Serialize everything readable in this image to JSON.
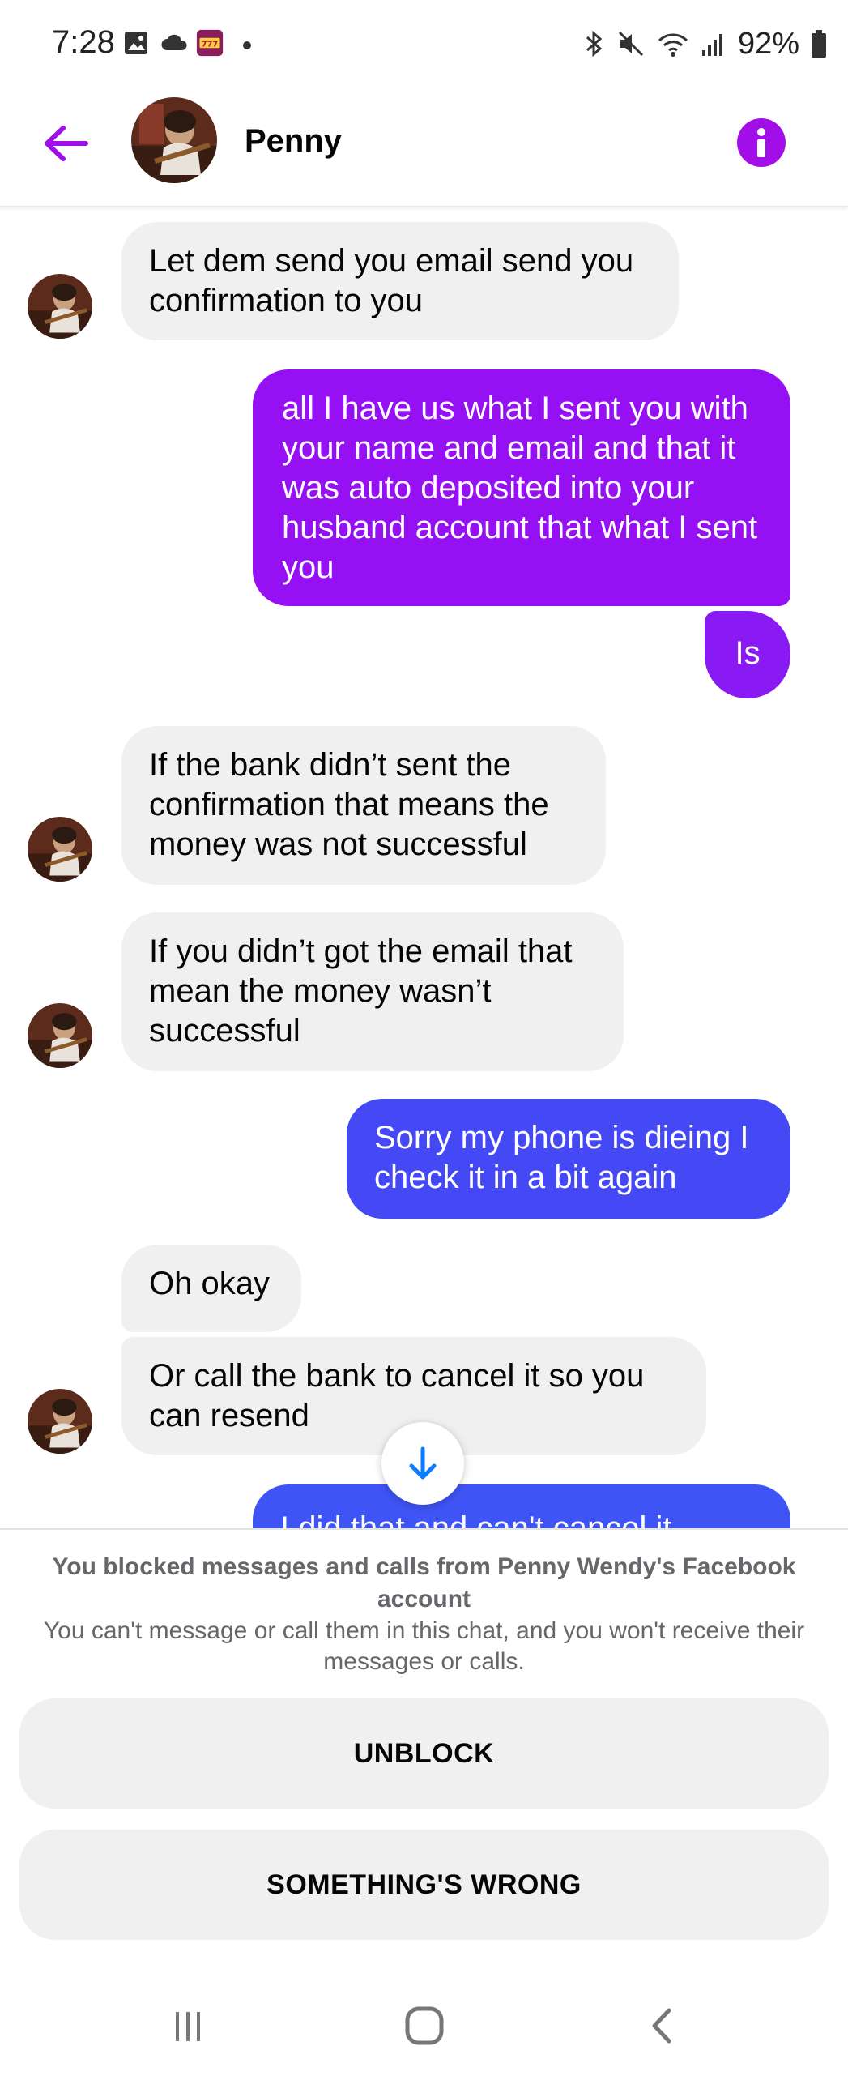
{
  "status_bar": {
    "time": "7:28",
    "battery": "92%",
    "left_icons": [
      "gallery-icon",
      "cloud-icon",
      "slots-app-icon",
      "dot-icon"
    ],
    "right_icons": [
      "bluetooth-icon",
      "mute-icon",
      "wifi-icon",
      "signal-icon",
      "battery-icon"
    ]
  },
  "header": {
    "contact_name": "Penny",
    "back_icon": "arrow-left-icon",
    "info_icon": "info-icon",
    "accent_color": "#a20ee8"
  },
  "messages": [
    {
      "direction": "incoming",
      "text": "Let dem send you email send you confirmation to you"
    },
    {
      "direction": "outgoing",
      "text": "all I have us what I sent you with your name and email and that it was auto deposited  into your husband account that what I sent you"
    },
    {
      "direction": "outgoing",
      "text": "Is"
    },
    {
      "direction": "incoming",
      "text": "If the bank didn’t sent the confirmation that means the money was not successful"
    },
    {
      "direction": "incoming",
      "text": "If you didn’t got the email that mean the money wasn’t successful"
    },
    {
      "direction": "outgoing",
      "text": "Sorry my phone is dieing I check it in a bit again"
    },
    {
      "direction": "incoming",
      "text": "Oh okay"
    },
    {
      "direction": "incoming",
      "text": "Or call the bank to cancel it so you can resend"
    },
    {
      "direction": "outgoing",
      "text": "I did that and can't cancel  it"
    }
  ],
  "blocked": {
    "title": "You blocked messages and calls from Penny Wendy's Facebook account",
    "description": "You can't message or call them in this chat, and you won't receive their messages or calls.",
    "unblock_label": "UNBLOCK",
    "something_wrong_label": "SOMETHING'S WRONG"
  },
  "colors": {
    "outgoing_top": "#9b0ff2",
    "outgoing_bottom": "#4a48f5",
    "incoming": "#f0f0f0",
    "scroll_arrow": "#0a7cff"
  },
  "nav_bar": {
    "icons": [
      "recent-apps-icon",
      "home-icon",
      "back-nav-icon"
    ]
  }
}
